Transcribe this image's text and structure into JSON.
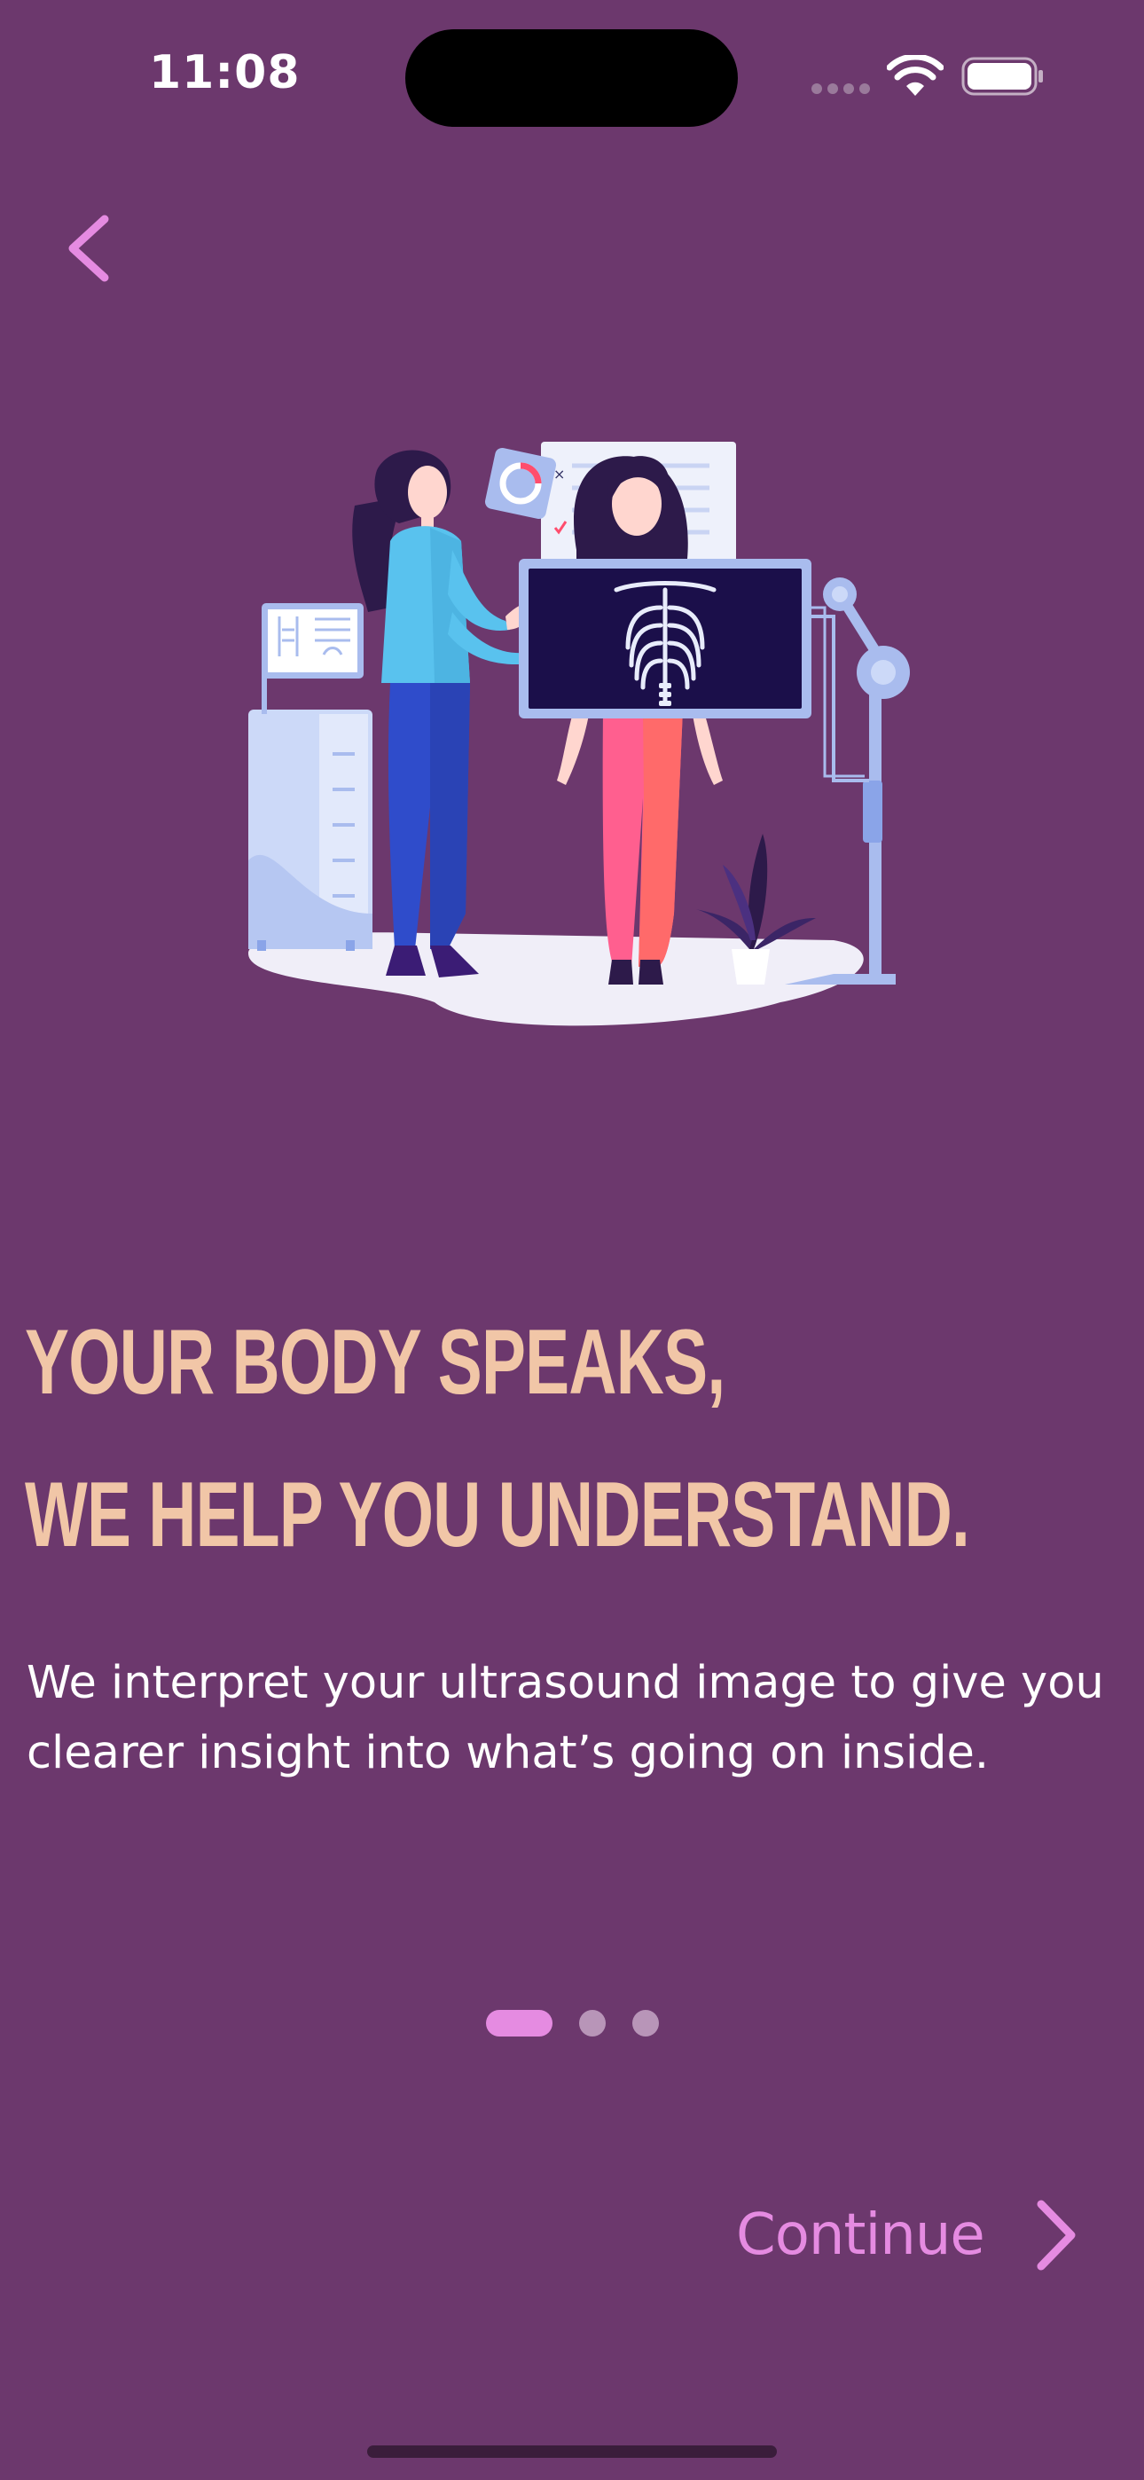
{
  "status_bar": {
    "time": "11:08"
  },
  "navigation": {
    "back_icon": "chevron-left-icon"
  },
  "illustration": {
    "icon": "doctor-xray-illustration"
  },
  "onboarding": {
    "headline_line1": "YOUR BODY SPEAKS,",
    "headline_line2": "WE HELP YOU UNDERSTAND.",
    "description": "We interpret your ultrasound image to give you clearer insight into what’s going on inside.",
    "page_count": 3,
    "current_page": 1
  },
  "actions": {
    "continue_label": "Continue",
    "continue_icon": "chevron-right-icon"
  },
  "colors": {
    "background": "#6c386d",
    "headline": "#f1c6a7",
    "accent": "#e58be1",
    "inactive_dot": "#b895b8"
  }
}
